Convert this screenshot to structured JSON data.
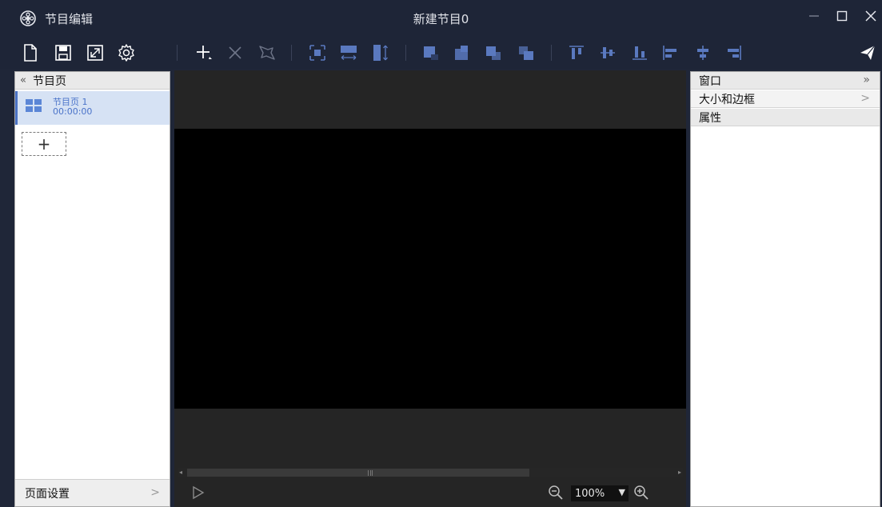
{
  "titlebar": {
    "app_name": "节目编辑",
    "doc_title": "新建节目0"
  },
  "toolbar": {
    "groups": [
      [
        "new-file-icon",
        "save-icon",
        "fullscreen-icon",
        "settings-gear-icon"
      ],
      [
        "add-plus-icon",
        "delete-x-icon",
        "pin-icon"
      ],
      [
        "fit-center-icon",
        "fit-width-icon",
        "fit-height-icon"
      ],
      [
        "layer-front-icon",
        "layer-back-icon",
        "layer-forward-icon",
        "layer-backward-icon"
      ],
      [
        "align-top-icon",
        "align-vcenter-icon",
        "align-bottom-icon",
        "align-left-icon",
        "align-hcenter-icon",
        "align-right-icon"
      ],
      [
        "send-icon"
      ]
    ]
  },
  "left_panel": {
    "header": "节目页",
    "pages": [
      {
        "name": "节目页 1",
        "duration": "00:00:00"
      }
    ],
    "add_label": "+",
    "footer": "页面设置"
  },
  "canvas": {
    "zoom": "100%"
  },
  "right_panel": {
    "window_label": "窗口",
    "size_border_label": "大小和边框",
    "attributes_label": "属性"
  },
  "colors": {
    "titlebar_bg": "#1e2537",
    "canvas_bg": "#000000",
    "accent_blue": "#4a72c4",
    "icon_blue": "#5a79bf"
  }
}
